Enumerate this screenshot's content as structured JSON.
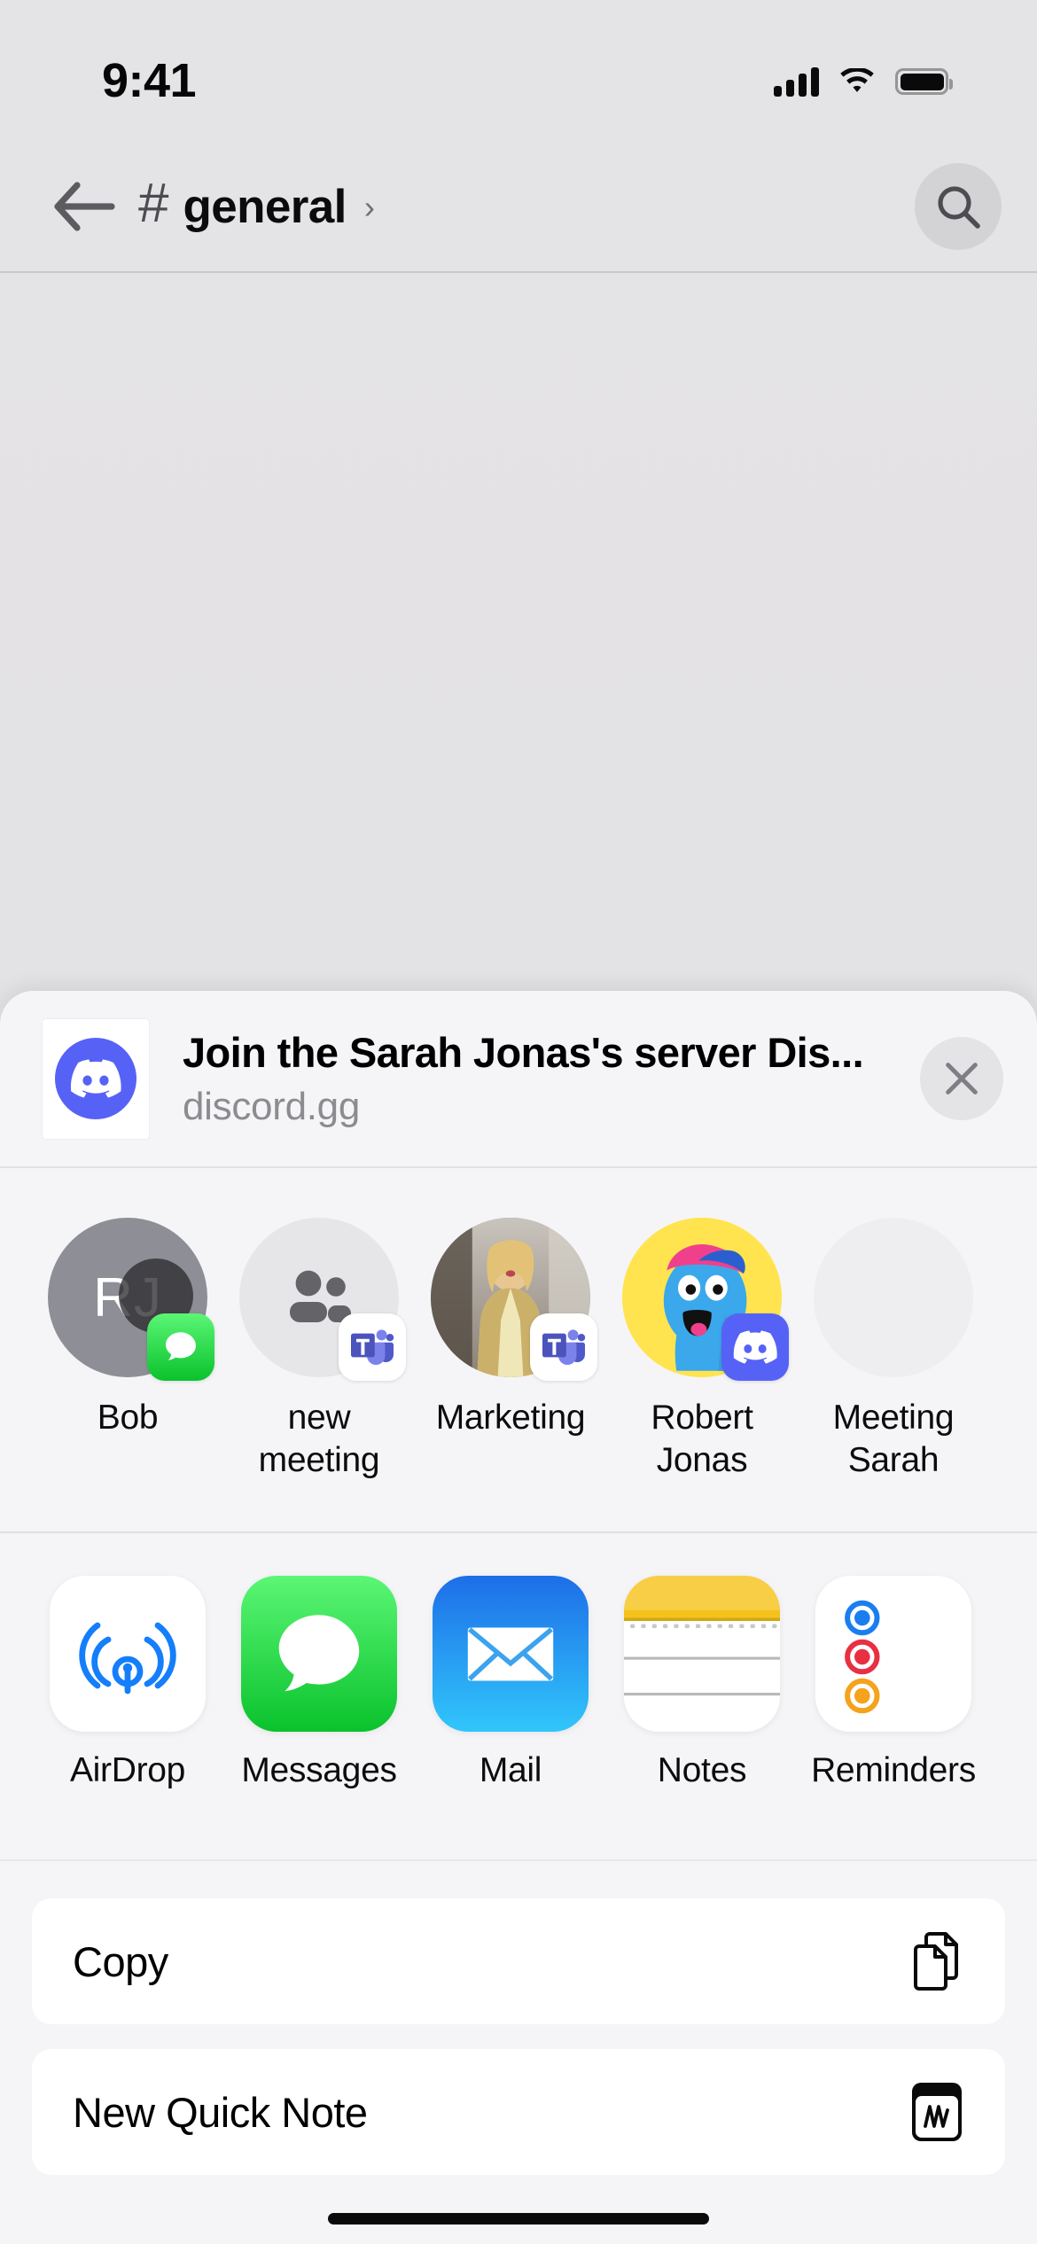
{
  "status_bar": {
    "time": "9:41",
    "cellular_icon": "cellular-bars-icon",
    "wifi_icon": "wifi-icon",
    "battery_icon": "battery-full-icon"
  },
  "nav_bar": {
    "back_icon": "arrow-left-icon",
    "hash_icon": "#",
    "channel_name": "general",
    "chevron": "›",
    "search_icon": "search-icon"
  },
  "share_sheet": {
    "link_preview": {
      "favicon": "discord-icon",
      "title": "Join the Sarah Jonas's server Dis...",
      "domain": "discord.gg",
      "close_icon": "close-icon"
    },
    "contacts": [
      {
        "name": "Bob",
        "avatar_type": "initials",
        "initials": "RJ",
        "badge": "messages-icon"
      },
      {
        "name": "new meeting",
        "avatar_type": "group",
        "initials": "",
        "badge": "teams-icon"
      },
      {
        "name": "Marketing",
        "avatar_type": "photo",
        "initials": "",
        "badge": "teams-icon"
      },
      {
        "name": "Robert Jonas",
        "avatar_type": "yellow",
        "initials": "",
        "badge": "discord-icon"
      },
      {
        "name": "Meeting Sarah",
        "avatar_type": "blank",
        "initials": "",
        "badge": ""
      }
    ],
    "apps": [
      {
        "name": "AirDrop",
        "icon": "airdrop-icon"
      },
      {
        "name": "Messages",
        "icon": "messages-icon"
      },
      {
        "name": "Mail",
        "icon": "mail-icon"
      },
      {
        "name": "Notes",
        "icon": "notes-icon"
      },
      {
        "name": "Reminders",
        "icon": "reminders-icon"
      }
    ],
    "actions": [
      {
        "label": "Copy",
        "icon": "copy-icon"
      },
      {
        "label": "New Quick Note",
        "icon": "quick-note-icon"
      }
    ]
  },
  "colors": {
    "discord_brand": "#5662f6",
    "messages_green": "#0ac22c",
    "mail_blue": "#1d6ee8",
    "notes_yellow": "#f7ce46",
    "background": "#e3e2e4",
    "sheet_background": "#f5f5f7"
  }
}
